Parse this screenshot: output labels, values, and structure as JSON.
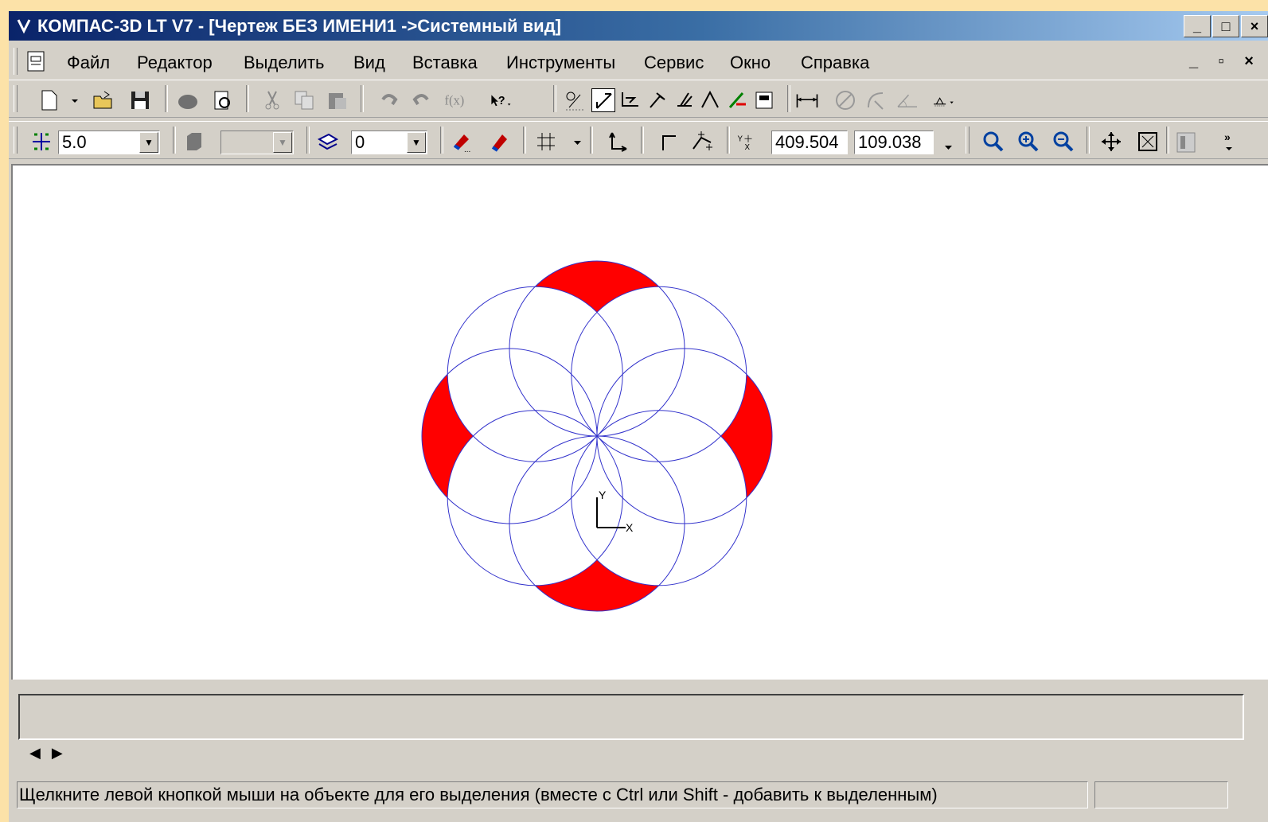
{
  "window": {
    "title": "КОМПАС-3D LT V7 - [Чертеж БЕЗ ИМЕНИ1 ->Системный вид]",
    "controls": [
      "_",
      "□",
      "×"
    ]
  },
  "menu": {
    "items": [
      "Файл",
      "Редактор",
      "Выделить",
      "Вид",
      "Вставка",
      "Инструменты",
      "Сервис",
      "Окно",
      "Справка"
    ],
    "mdi_controls": "_ ▫ ×"
  },
  "toolbar2": {
    "step_value": "5.0",
    "layer_value": "0",
    "coord_x": "409.504",
    "coord_y": "109.038"
  },
  "drawing": {
    "fill_color": "#FF0000",
    "line_color": "#3333CC",
    "axis_y_label": "Y",
    "axis_x_label": "X"
  },
  "statusbar": {
    "hint": "Щелкните левой кнопкой мыши на объекте для его выделения (вместе с Ctrl или Shift - добавить к выделенным)"
  },
  "colors": {
    "background": "#FCE2A8",
    "titlebar": "#0A246A",
    "face": "#D4D0C8"
  }
}
